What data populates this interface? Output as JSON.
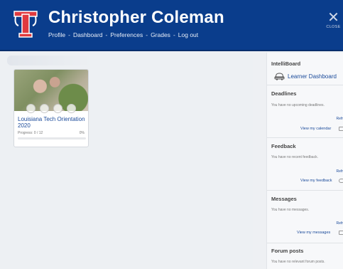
{
  "header": {
    "user_name": "Christopher Coleman",
    "nav": [
      "Profile",
      "Dashboard",
      "Preferences",
      "Grades",
      "Log out"
    ],
    "separator": "-",
    "close_label": "CLOSE",
    "logo_letter": "T",
    "brand_color": "#0a3d8c"
  },
  "course": {
    "title": "Louisiana Tech Orientation 2020",
    "progress_label": "Progress: 0 / 12",
    "progress_percent": "0%",
    "progress_fraction": 0
  },
  "sidebar": {
    "intelliboard": {
      "title": "IntelliBoard",
      "link": "Learner Dashboard",
      "icon": "car-icon"
    },
    "deadlines": {
      "title": "Deadlines",
      "text": "You have no upcoming deadlines.",
      "refresh": "Refr",
      "link": "View my calendar",
      "icon": "calendar-icon"
    },
    "feedback": {
      "title": "Feedback",
      "text": "You have no recent feedback.",
      "refresh": "Refr",
      "link": "View my feedback",
      "icon": "feedback-icon"
    },
    "messages": {
      "title": "Messages",
      "text": "You have no messages.",
      "refresh": "Refr",
      "link": "View my messages",
      "icon": "message-icon"
    },
    "forum": {
      "title": "Forum posts",
      "text": "You have no relevant forum posts."
    }
  }
}
